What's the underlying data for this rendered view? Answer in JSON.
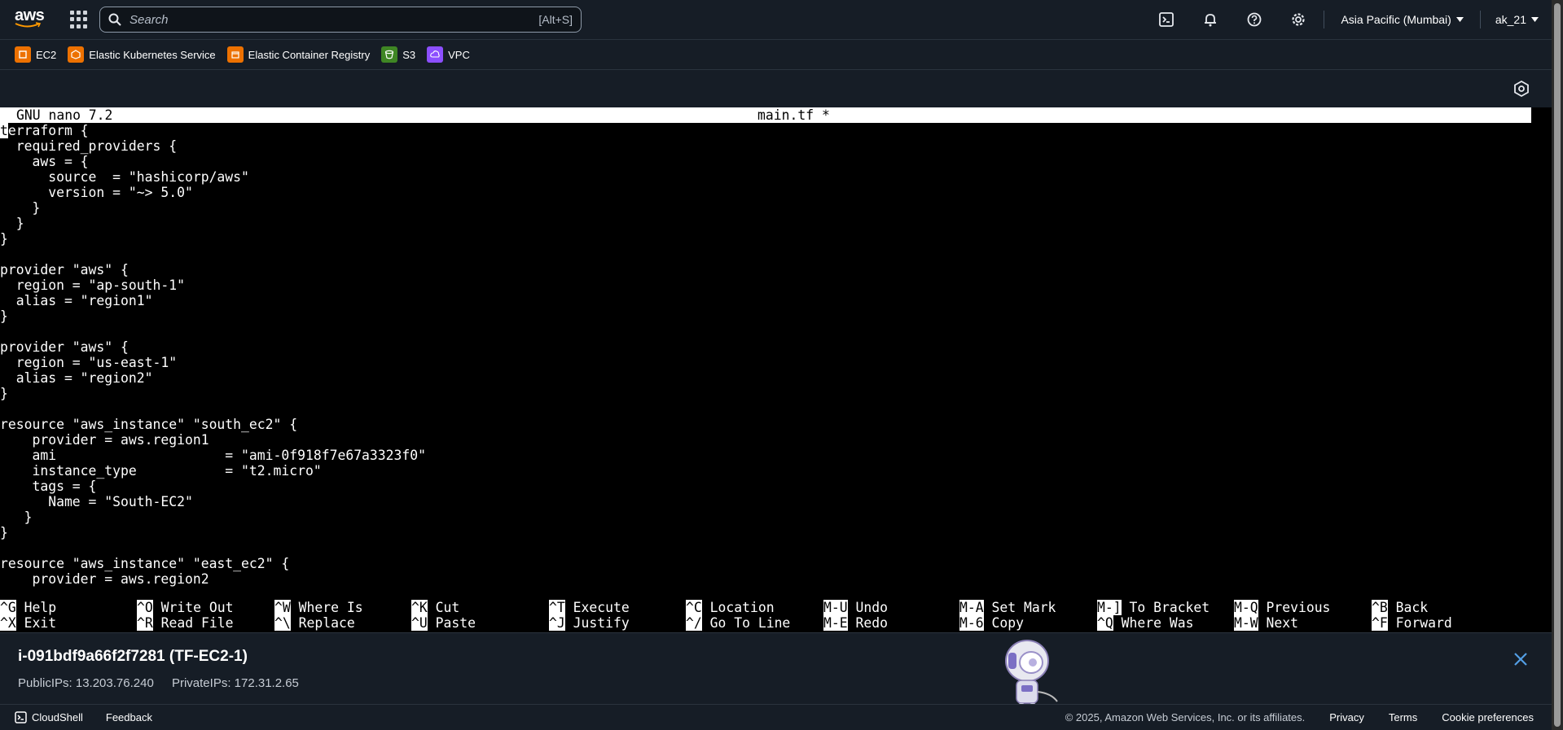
{
  "nav": {
    "logo_text": "aws",
    "search_placeholder": "Search",
    "search_shortcut": "[Alt+S]",
    "region": "Asia Pacific (Mumbai)",
    "user": "ak_21"
  },
  "favorites": [
    {
      "label": "EC2",
      "icon": "ec2-icon",
      "color": "#ed7100"
    },
    {
      "label": "Elastic Kubernetes Service",
      "icon": "eks-icon",
      "color": "#ed7100"
    },
    {
      "label": "Elastic Container Registry",
      "icon": "ecr-icon",
      "color": "#ed7100"
    },
    {
      "label": "S3",
      "icon": "s3-icon",
      "color": "#3f8624"
    },
    {
      "label": "VPC",
      "icon": "vpc-icon",
      "color": "#8c4fff"
    }
  ],
  "nano": {
    "version": "GNU nano 7.2",
    "filename": "main.tf *",
    "cursor_char": "t",
    "first_line_rest": "erraform {",
    "lines": [
      "  required_providers {",
      "    aws = {",
      "      source  = \"hashicorp/aws\"",
      "      version = \"~> 5.0\"",
      "    }",
      "  }",
      "}",
      "",
      "provider \"aws\" {",
      "  region = \"ap-south-1\"",
      "  alias = \"region1\"",
      "}",
      "",
      "provider \"aws\" {",
      "  region = \"us-east-1\"",
      "  alias = \"region2\"",
      "}",
      "",
      "resource \"aws_instance\" \"south_ec2\" {",
      "    provider = aws.region1",
      "    ami                     = \"ami-0f918f7e67a3323f0\"",
      "    instance_type           = \"t2.micro\"",
      "    tags = {",
      "      Name = \"South-EC2\"",
      "   }",
      "}",
      "",
      "resource \"aws_instance\" \"east_ec2\" {",
      "    provider = aws.region2"
    ],
    "shortcuts_row1": [
      {
        "key": "^G",
        "label": "Help"
      },
      {
        "key": "^O",
        "label": "Write Out"
      },
      {
        "key": "^W",
        "label": "Where Is"
      },
      {
        "key": "^K",
        "label": "Cut"
      },
      {
        "key": "^T",
        "label": "Execute"
      },
      {
        "key": "^C",
        "label": "Location"
      },
      {
        "key": "M-U",
        "label": "Undo"
      },
      {
        "key": "M-A",
        "label": "Set Mark"
      },
      {
        "key": "M-]",
        "label": "To Bracket"
      },
      {
        "key": "M-Q",
        "label": "Previous"
      },
      {
        "key": "^B",
        "label": "Back"
      }
    ],
    "shortcuts_row2": [
      {
        "key": "^X",
        "label": "Exit"
      },
      {
        "key": "^R",
        "label": "Read File"
      },
      {
        "key": "^\\",
        "label": "Replace"
      },
      {
        "key": "^U",
        "label": "Paste"
      },
      {
        "key": "^J",
        "label": "Justify"
      },
      {
        "key": "^/",
        "label": "Go To Line"
      },
      {
        "key": "M-E",
        "label": "Redo"
      },
      {
        "key": "M-6",
        "label": "Copy"
      },
      {
        "key": "^Q",
        "label": "Where Was"
      },
      {
        "key": "M-W",
        "label": "Next"
      },
      {
        "key": "^F",
        "label": "Forward"
      }
    ]
  },
  "instance": {
    "title": "i-091bdf9a66f2f7281 (TF-EC2-1)",
    "public_ips": "PublicIPs: 13.203.76.240",
    "private_ips": "PrivateIPs: 172.31.2.65"
  },
  "footer": {
    "cloudshell": "CloudShell",
    "feedback": "Feedback",
    "copyright": "© 2025, Amazon Web Services, Inc. or its affiliates.",
    "privacy": "Privacy",
    "terms": "Terms",
    "cookies": "Cookie preferences"
  }
}
